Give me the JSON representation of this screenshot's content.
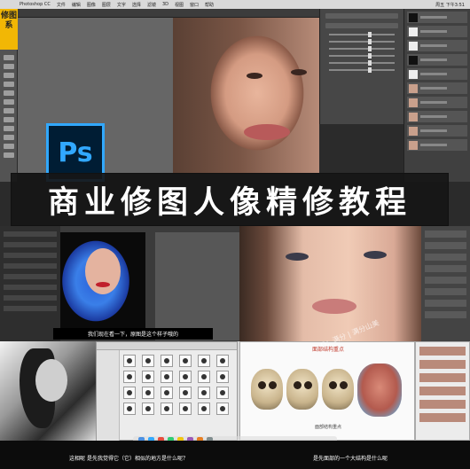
{
  "menubar": {
    "items": [
      "Photoshop CC",
      "文件",
      "编辑",
      "图像",
      "图层",
      "文字",
      "选择",
      "滤镜",
      "3D",
      "视图",
      "窗口",
      "帮助"
    ],
    "clock": "周五 下午3:51"
  },
  "badge": {
    "text": "修图系"
  },
  "logo": {
    "text": "Ps"
  },
  "banner": {
    "title": "商业修图人像精修教程"
  },
  "captions": {
    "blue_photo": "我们现在看一下，原图是这个样子哦的",
    "bottom_left": "这相呢 是先我觉得它（它）相似的地方是什么呢？",
    "bottom_right": "是先面部的一个大结构是什么呢"
  },
  "slide": {
    "title": "面部结构重点",
    "caption": "面部结构重点"
  },
  "watermark": {
    "text": "Q：满分 | 满分山美"
  },
  "colors": {
    "ps_blue": "#31a8ff",
    "ps_dark": "#001d34",
    "badge_yellow": "#f2b705"
  }
}
